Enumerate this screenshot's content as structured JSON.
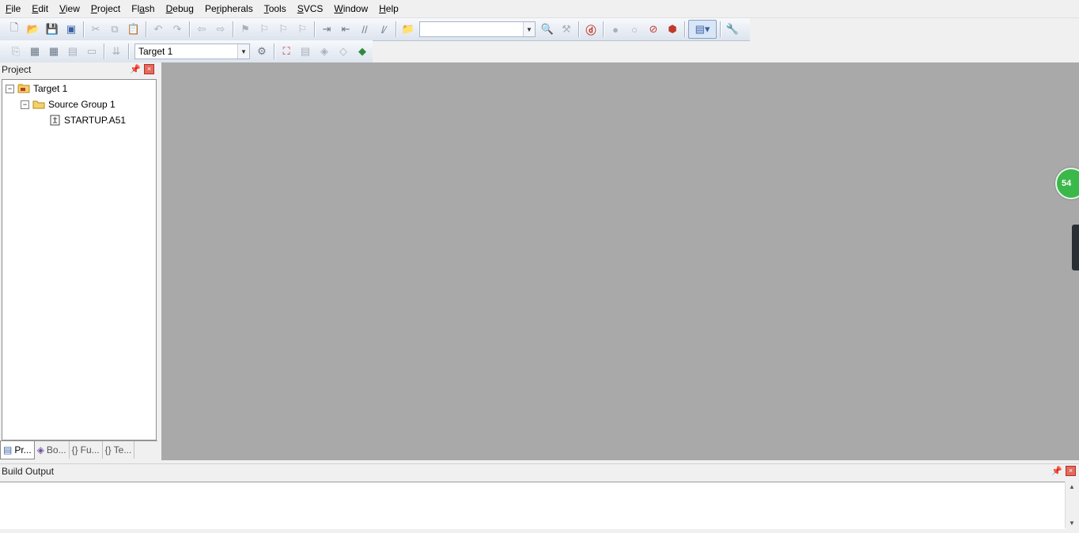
{
  "menu": [
    {
      "pre": "",
      "u": "F",
      "post": "ile"
    },
    {
      "pre": "",
      "u": "E",
      "post": "dit"
    },
    {
      "pre": "",
      "u": "V",
      "post": "iew"
    },
    {
      "pre": "",
      "u": "P",
      "post": "roject"
    },
    {
      "pre": "Fl",
      "u": "a",
      "post": "sh"
    },
    {
      "pre": "",
      "u": "D",
      "post": "ebug"
    },
    {
      "pre": "Pe",
      "u": "r",
      "post": "ipherals"
    },
    {
      "pre": "",
      "u": "T",
      "post": "ools"
    },
    {
      "pre": "",
      "u": "S",
      "post": "VCS"
    },
    {
      "pre": "",
      "u": "W",
      "post": "indow"
    },
    {
      "pre": "",
      "u": "H",
      "post": "elp"
    }
  ],
  "toolbar": {
    "find_combo_value": "",
    "target_combo_value": "Target 1"
  },
  "project_pane": {
    "title": "Project",
    "tree": {
      "target": "Target 1",
      "group": "Source Group 1",
      "file": "STARTUP.A51"
    },
    "tabs": [
      "Pr...",
      "Bo...",
      "Fu...",
      "Te..."
    ]
  },
  "badge_text": "54",
  "build_output": {
    "title": "Build Output"
  },
  "colors": {
    "editor_bg": "#aaa9a9",
    "accent_red": "#c0392b",
    "badge_green": "#3bb84a"
  }
}
